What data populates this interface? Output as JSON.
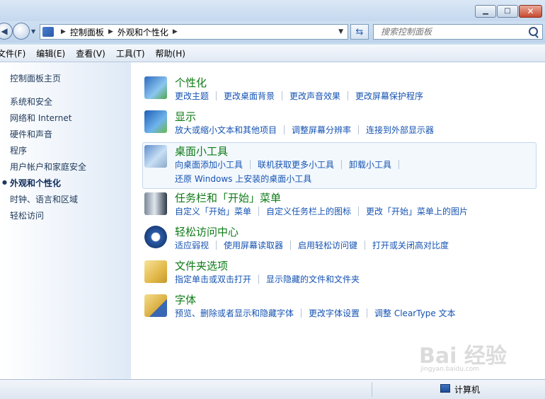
{
  "window": {
    "minimize_icon": "minimize-icon",
    "maximize_icon": "maximize-icon",
    "close_icon": "close-icon"
  },
  "nav": {
    "breadcrumb": [
      "控制面板",
      "外观和个性化"
    ],
    "search_placeholder": "搜索控制面板",
    "back_icon": "back-arrow-icon",
    "forward_icon": "forward-arrow-icon",
    "refresh_icon": "refresh-icon"
  },
  "menu": [
    "文件(F)",
    "编辑(E)",
    "查看(V)",
    "工具(T)",
    "帮助(H)"
  ],
  "sidebar": {
    "home": "控制面板主页",
    "items": [
      "系统和安全",
      "网络和 Internet",
      "硬件和声音",
      "程序",
      "用户帐户和家庭安全",
      "外观和个性化",
      "时钟、语言和区域",
      "轻松访问"
    ],
    "active_index": 5
  },
  "categories": [
    {
      "title": "个性化",
      "icon": "personalization-icon",
      "links": [
        [
          "更改主题",
          "更改桌面背景",
          "更改声音效果",
          "更改屏幕保护程序"
        ]
      ]
    },
    {
      "title": "显示",
      "icon": "display-icon",
      "links": [
        [
          "放大或缩小文本和其他项目",
          "调整屏幕分辨率",
          "连接到外部显示器"
        ]
      ]
    },
    {
      "title": "桌面小工具",
      "icon": "gadgets-icon",
      "links": [
        [
          "向桌面添加小工具",
          "联机获取更多小工具",
          "卸载小工具"
        ],
        [
          "还原 Windows 上安装的桌面小工具"
        ]
      ]
    },
    {
      "title": "任务栏和「开始」菜单",
      "icon": "taskbar-icon",
      "links": [
        [
          "自定义「开始」菜单",
          "自定义任务栏上的图标",
          "更改「开始」菜单上的图片"
        ]
      ]
    },
    {
      "title": "轻松访问中心",
      "icon": "ease-of-access-icon",
      "links": [
        [
          "适应弱视",
          "使用屏幕读取器",
          "启用轻松访问键",
          "打开或关闭高对比度"
        ]
      ]
    },
    {
      "title": "文件夹选项",
      "icon": "folder-options-icon",
      "links": [
        [
          "指定单击或双击打开",
          "显示隐藏的文件和文件夹"
        ]
      ]
    },
    {
      "title": "字体",
      "icon": "fonts-icon",
      "links": [
        [
          "预览、删除或者显示和隐藏字体",
          "更改字体设置",
          "调整 ClearType 文本"
        ]
      ]
    }
  ],
  "status": {
    "computer": "计算机"
  },
  "watermark": {
    "main": "Bai 经验",
    "sub": "jingyan.baidu.com"
  }
}
